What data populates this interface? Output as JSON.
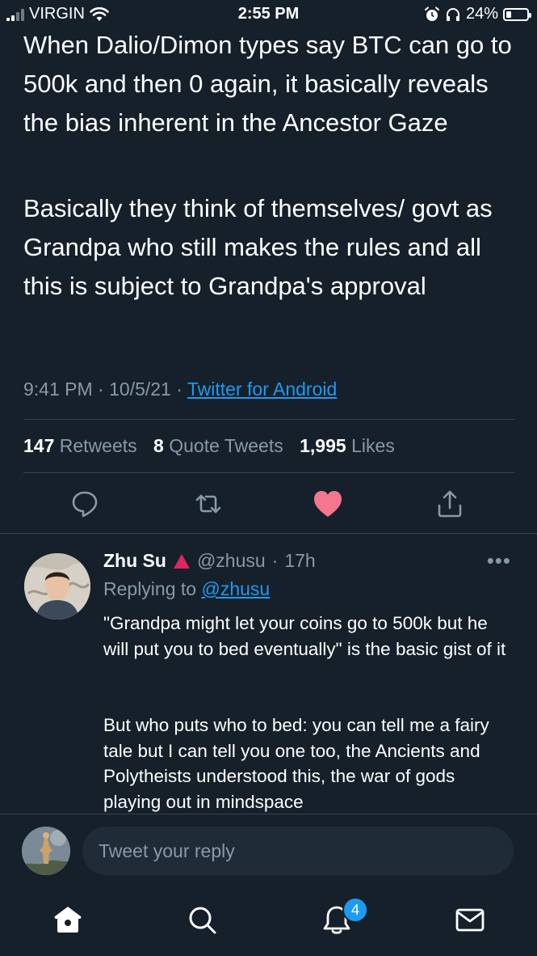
{
  "status_bar": {
    "carrier": "VIRGIN",
    "time": "2:55 PM",
    "battery": "24%",
    "battery_fraction": 0.24,
    "icons": [
      "signal-icon",
      "wifi-icon",
      "alarm-icon",
      "headphones-icon",
      "battery-icon"
    ]
  },
  "tweet": {
    "paragraph1": "When Dalio/Dimon types say BTC can go to 500k and then 0 again, it basically reveals the bias inherent in the Ancestor Gaze",
    "paragraph2": "Basically they think of themselves/ govt as Grandpa who still makes the rules and all this is subject to Grandpa's approval",
    "time": "9:41 PM",
    "separator": "·",
    "date": "10/5/21",
    "source": "Twitter for Android",
    "retweets_count": "147",
    "retweets_label": "Retweets",
    "quotes_count": "8",
    "quotes_label": "Quote Tweets",
    "likes_count": "1,995",
    "likes_label": "Likes",
    "like_color": "#f4768f"
  },
  "reply": {
    "name": "Zhu Su",
    "handle": "@zhusu",
    "separator": "·",
    "age": "17h",
    "more": "•••",
    "replying_label": "Replying to",
    "replying_handle": "@zhusu",
    "paragraph1": "\"Grandpa might let your coins go to 500k but he will put you to bed eventually\" is the basic gist of it",
    "paragraph2": "But who puts who to bed: you can tell me a fairy tale but I can tell you one too, the Ancients and Polytheists understood this, the war of gods playing out in mindspace",
    "badge_color": "#e0245e"
  },
  "compose": {
    "placeholder": "Tweet your reply"
  },
  "tab_bar": {
    "notifications_badge": "4",
    "icons": [
      "home-icon",
      "search-icon",
      "notifications-icon",
      "messages-icon"
    ]
  },
  "colors": {
    "background": "#15202b",
    "accent": "#1d9bf0",
    "muted": "#8899a6"
  }
}
